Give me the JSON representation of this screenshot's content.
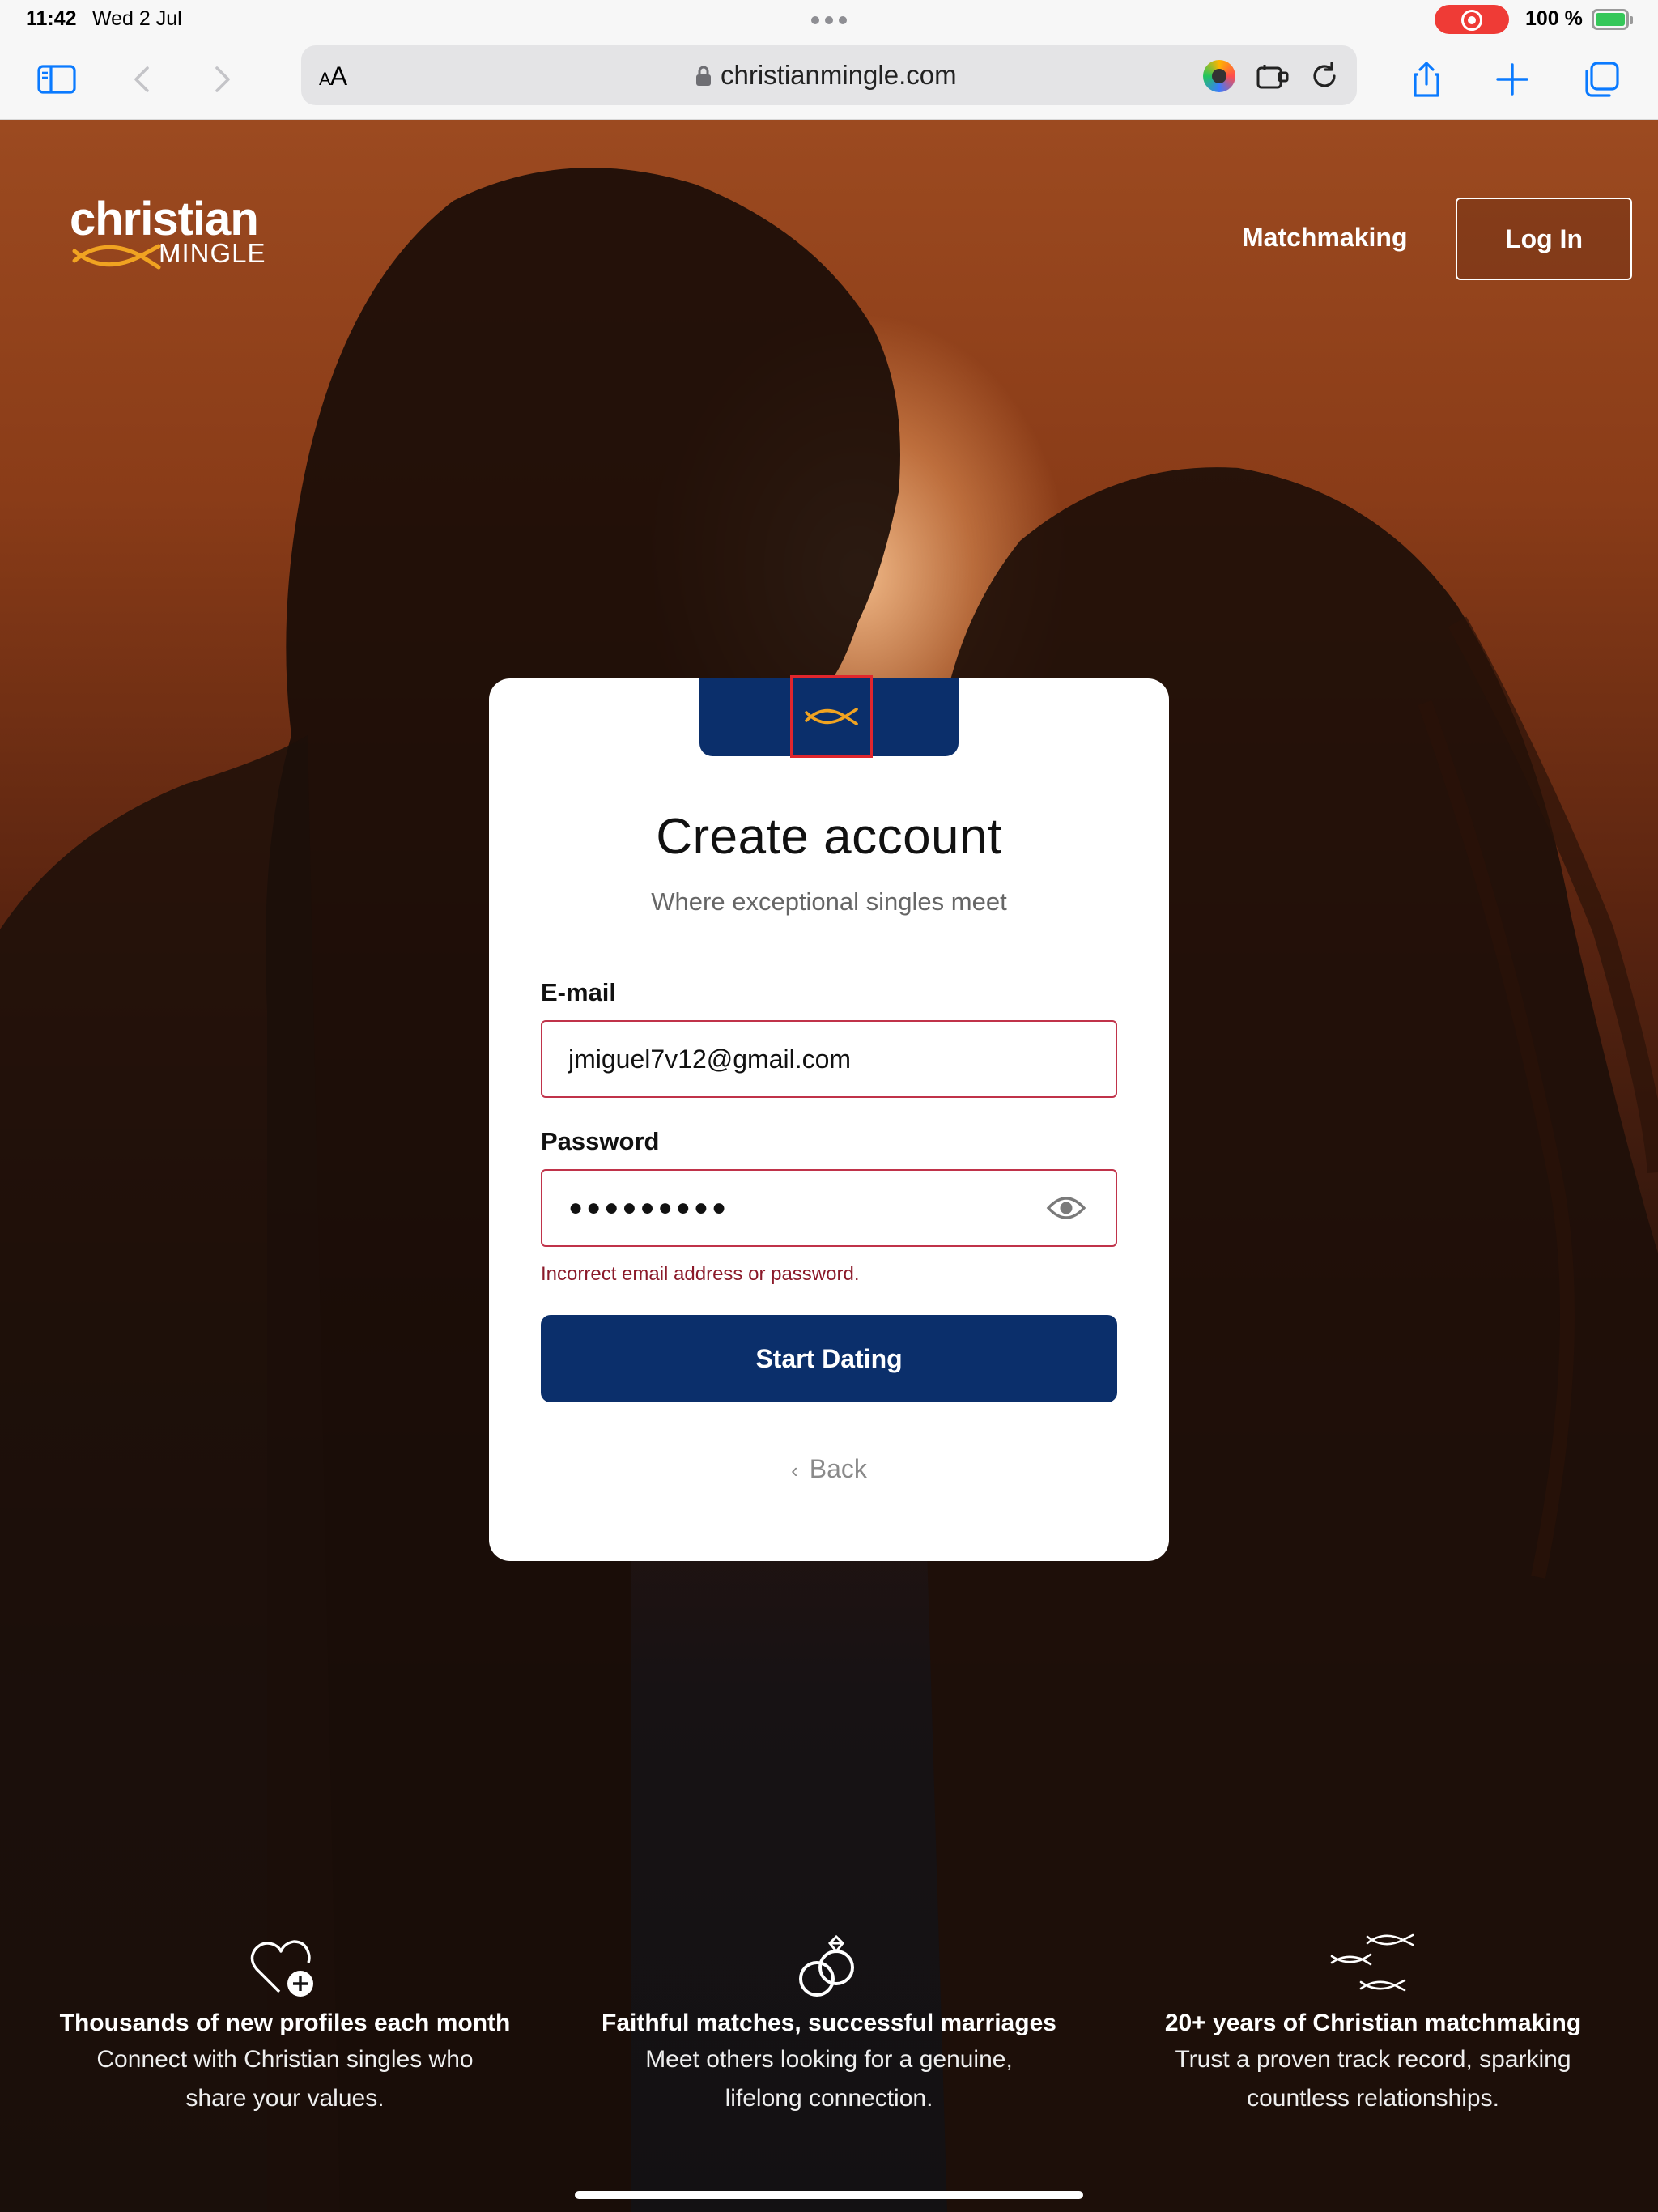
{
  "status_bar": {
    "time": "11:42",
    "date": "Wed 2 Jul",
    "battery_text": "100 %"
  },
  "browser": {
    "text_size_label": "AA",
    "url": "christianmingle.com",
    "icons": [
      "sidebar-icon",
      "back-icon",
      "forward-icon",
      "lock-icon",
      "extension-icon",
      "puzzle-icon",
      "reload-icon",
      "share-icon",
      "new-tab-icon",
      "tabs-icon"
    ]
  },
  "site": {
    "brand_word": "christian",
    "brand_sub": "MINGLE",
    "nav_matchmaking": "Matchmaking",
    "login_label": "Log In"
  },
  "form": {
    "title": "Create account",
    "subtitle": "Where exceptional singles meet",
    "email_label": "E-mail",
    "email_value": "jmiguel7v12@gmail.com",
    "password_label": "Password",
    "password_value": "●●●●●●●●●",
    "error": "Incorrect email address or password.",
    "submit_label": "Start Dating",
    "back_label": "Back"
  },
  "features": [
    {
      "icon": "heart-plus-icon",
      "title": "Thousands of new profiles each month",
      "desc_line1": "Connect with Christian singles who",
      "desc_line2": "share your values."
    },
    {
      "icon": "rings-icon",
      "title": "Faithful matches, successful marriages",
      "desc_line1": "Meet others looking for a genuine,",
      "desc_line2": "lifelong connection."
    },
    {
      "icon": "fishes-icon",
      "title": "20+ years of Christian matchmaking",
      "desc_line1": "Trust a proven track record, sparking",
      "desc_line2": "countless relationships."
    }
  ],
  "colors": {
    "brand_navy": "#0b2f6b",
    "accent_gold": "#f0a321",
    "error_red": "#8b1a2a",
    "field_border_error": "#c0334a",
    "browser_blue": "#0a7aff"
  }
}
